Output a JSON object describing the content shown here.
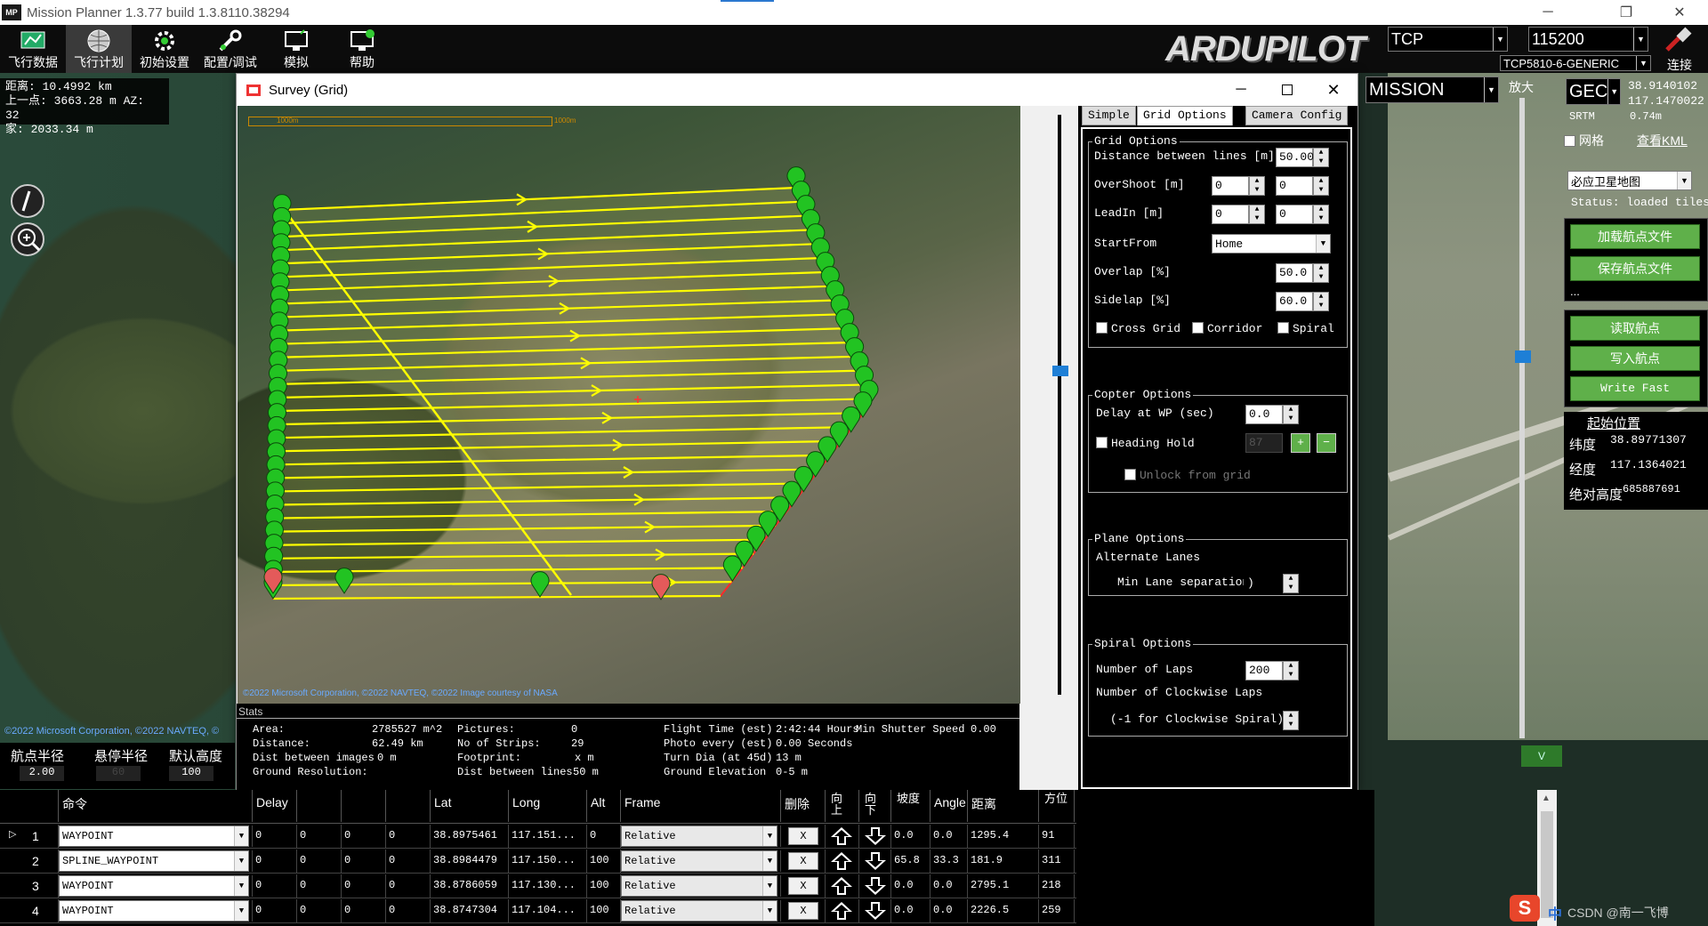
{
  "window": {
    "title": "Mission Planner 1.3.77 build 1.3.8110.38294",
    "logo": "MP",
    "minimize": "─",
    "restore": "❐",
    "close": "✕"
  },
  "toolbar": {
    "items": [
      {
        "label": "飞行数据",
        "icon": "flight-data-icon"
      },
      {
        "label": "飞行计划",
        "icon": "flight-plan-icon"
      },
      {
        "label": "初始设置",
        "icon": "initial-setup-icon"
      },
      {
        "label": "配置/调试",
        "icon": "config-tuning-icon"
      },
      {
        "label": "模拟",
        "icon": "simulation-icon"
      },
      {
        "label": "帮助",
        "icon": "help-icon"
      }
    ],
    "brand": "ARDUPILOT",
    "connection_type": "TCP",
    "baud": "115200",
    "device": "TCP5810-6-GENERIC",
    "connect_label": "连接"
  },
  "hud": {
    "distance": "距离: 10.4992 km",
    "prev_point": "上一点: 3663.28 m AZ: 32",
    "home": "家: 2033.34 m"
  },
  "map_right": {
    "mode": "MISSION",
    "zoom_label": "放大",
    "geo": "GEC",
    "lat": "38.9140102",
    "lng": "117.1470022",
    "srtm_label": "SRTM",
    "srtm_value": "0.74m",
    "grid_label": "网格",
    "view_kml": "查看KML",
    "map_type": "必应卫星地图",
    "status": "Status: loaded tiles",
    "load_wp": "加载航点文件",
    "save_wp": "保存航点文件",
    "dots": "...",
    "read_wp": "读取航点",
    "write_wp": "写入航点",
    "write_fast": "Write Fast",
    "home_title": "起始位置",
    "lat_label": "纬度",
    "lat_value": "38.89771307",
    "lng_label": "经度",
    "lng_value": "117.1364021",
    "alt_label": "绝对高度",
    "alt_value": "685887691",
    "v_btn": "V"
  },
  "bottom_left": {
    "wp_radius_label": "航点半径",
    "wp_radius": "2.00",
    "loiter_label": "悬停半径",
    "loiter": "60",
    "alt_label": "默认高度",
    "alt": "100",
    "copyright": "©2022 Microsoft Corporation, ©2022 NAVTEQ, ©"
  },
  "survey": {
    "title": "Survey (Grid)",
    "scale_label": "1000m",
    "copyright": "©2022 Microsoft Corporation, ©2022 NAVTEQ, ©2022 Image courtesy of NASA",
    "tabs": [
      "Simple",
      "Grid Options",
      "Camera Config"
    ],
    "grid_options": {
      "title": "Grid Options",
      "distance_label": "Distance between lines [m]",
      "distance": "50.00",
      "overshoot_label": "OverShoot [m]",
      "overshoot_a": "0",
      "overshoot_b": "0",
      "leadin_label": "LeadIn [m]",
      "leadin_a": "0",
      "leadin_b": "0",
      "startfrom_label": "StartFrom",
      "startfrom": "Home",
      "overlap_label": "Overlap [%]",
      "overlap": "50.0",
      "sidelap_label": "Sidelap [%]",
      "sidelap": "60.0",
      "crossgrid": "Cross Grid",
      "corridor": "Corridor",
      "spiral": "Spiral"
    },
    "copter_options": {
      "title": "Copter Options",
      "delay_label": "Delay at WP (sec)",
      "delay": "0.0",
      "heading_label": "Heading Hold",
      "heading": "87",
      "unlock_label": "Unlock from grid",
      "plus": "+",
      "minus": "−"
    },
    "plane_options": {
      "title": "Plane Options",
      "alt_lanes": "Alternate Lanes",
      "min_lane_label": "Min Lane separation",
      "min_lane": ")"
    },
    "spiral_options": {
      "title": "Spiral Options",
      "laps_label": "Number of Laps",
      "laps": "200",
      "cw_laps_label": "Number of Clockwise Laps",
      "cw_note": "(-1 for Clockwise Spiral)"
    },
    "stats": {
      "title": "Stats",
      "area_label": "Area:",
      "area": "2785527 m^2",
      "distance_label": "Distance:",
      "distance": "62.49 km",
      "dist_images_label": "Dist between images",
      "dist_images": "0 m",
      "ground_res_label": "Ground Resolution:",
      "pictures_label": "Pictures:",
      "pictures": "0",
      "strips_label": "No of Strips:",
      "strips": "29",
      "footprint_label": "Footprint:",
      "footprint": "x  m",
      "dist_lines_label": "Dist between lines",
      "dist_lines": "50 m",
      "flight_time_label": "Flight Time (est)",
      "flight_time": "2:42:44 Hours",
      "min_shutter_label": "Min Shutter Speed",
      "min_shutter": "0.00",
      "photo_every_label": "Photo every (est)",
      "photo_every": "0.00 Seconds",
      "turn_dia_label": "Turn Dia (at 45d)",
      "turn_dia": "13 m",
      "ground_elev_label": "Ground Elevation",
      "ground_elev": "0-5 m"
    }
  },
  "table": {
    "headers": [
      "",
      "命令",
      "Delay",
      "",
      "",
      "",
      "Lat",
      "Long",
      "Alt",
      "Frame",
      "删除",
      "向上",
      "向下",
      "坡度",
      "Angle",
      "距离",
      "方位"
    ],
    "rows": [
      {
        "n": "1",
        "cmd": "WAYPOINT",
        "p1": "0",
        "p2": "0",
        "p3": "0",
        "p4": "0",
        "lat": "38.8975461",
        "lng": "117.151...",
        "alt": "0",
        "frame": "Relative",
        "del": "X",
        "grad": "0.0",
        "angle": "0.0",
        "dist": "1295.4",
        "az": "91"
      },
      {
        "n": "2",
        "cmd": "SPLINE_WAYPOINT",
        "p1": "0",
        "p2": "0",
        "p3": "0",
        "p4": "0",
        "lat": "38.8984479",
        "lng": "117.150...",
        "alt": "100",
        "frame": "Relative",
        "del": "X",
        "grad": "65.8",
        "angle": "33.3",
        "dist": "181.9",
        "az": "311"
      },
      {
        "n": "3",
        "cmd": "WAYPOINT",
        "p1": "0",
        "p2": "0",
        "p3": "0",
        "p4": "0",
        "lat": "38.8786059",
        "lng": "117.130...",
        "alt": "100",
        "frame": "Relative",
        "del": "X",
        "grad": "0.0",
        "angle": "0.0",
        "dist": "2795.1",
        "az": "218"
      },
      {
        "n": "4",
        "cmd": "WAYPOINT",
        "p1": "0",
        "p2": "0",
        "p3": "0",
        "p4": "0",
        "lat": "38.8747304",
        "lng": "117.104...",
        "alt": "100",
        "frame": "Relative",
        "del": "X",
        "grad": "0.0",
        "angle": "0.0",
        "dist": "2226.5",
        "az": "259"
      }
    ]
  },
  "watermark": {
    "brand": "中",
    "text": "CSDN @南一飞博"
  },
  "colors": {
    "survey_line": "#ffff00",
    "boundary": "#ff2a2a",
    "marker": "#22c322",
    "accent": "#5fb04a"
  }
}
